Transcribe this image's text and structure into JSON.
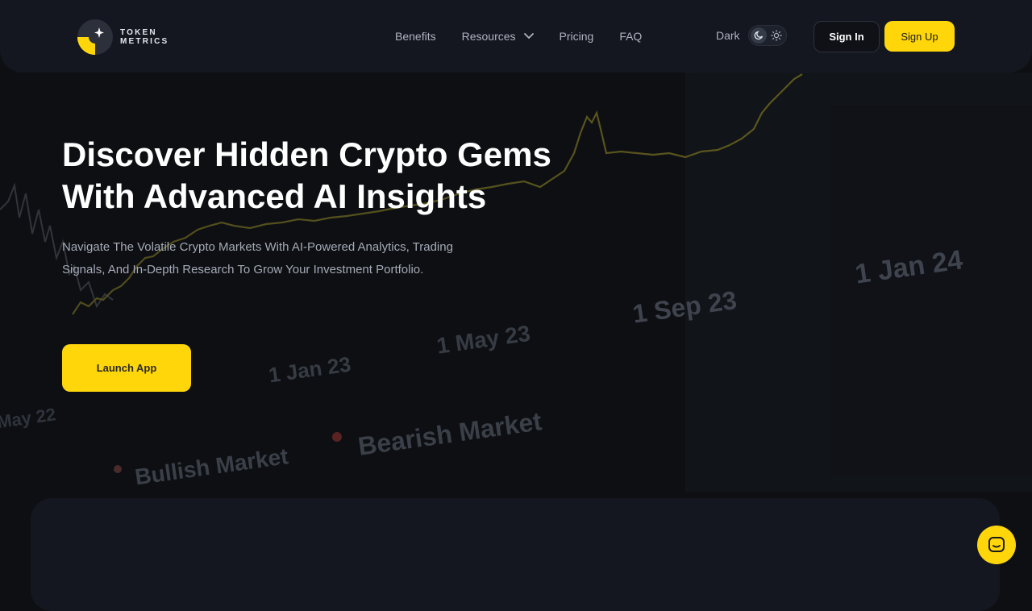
{
  "brand": {
    "name_line1": "TOKEN",
    "name_line2": "METRICS"
  },
  "nav": {
    "benefits": "Benefits",
    "resources": "Resources",
    "pricing": "Pricing",
    "faq": "FAQ"
  },
  "theme": {
    "label": "Dark",
    "mode": "dark"
  },
  "auth": {
    "sign_in": "Sign In",
    "sign_up": "Sign Up"
  },
  "hero": {
    "title_line1": "Discover Hidden Crypto Gems",
    "title_line2": "With Advanced AI Insights",
    "subtitle_line1": "Navigate The Volatile Crypto Markets With AI-Powered Analytics, Trading",
    "subtitle_line2": "Signals, And In-Depth Research To Grow Your Investment Portfolio.",
    "cta": "Launch App"
  },
  "background_chart": {
    "date_labels": [
      "May 22",
      "1 Jan 23",
      "1 May 23",
      "1 Sep 23",
      "1 Jan 24"
    ],
    "legend": {
      "bullish": "Bullish Market",
      "bearish": "Bearish Market"
    }
  },
  "colors": {
    "accent": "#ffd60a",
    "background": "#0d0f13",
    "panel": "#141720"
  },
  "icons": {
    "chat": "chat-bubble-icon",
    "moon": "moon-icon",
    "sun": "sun-icon",
    "chevron": "chevron-down-icon"
  }
}
